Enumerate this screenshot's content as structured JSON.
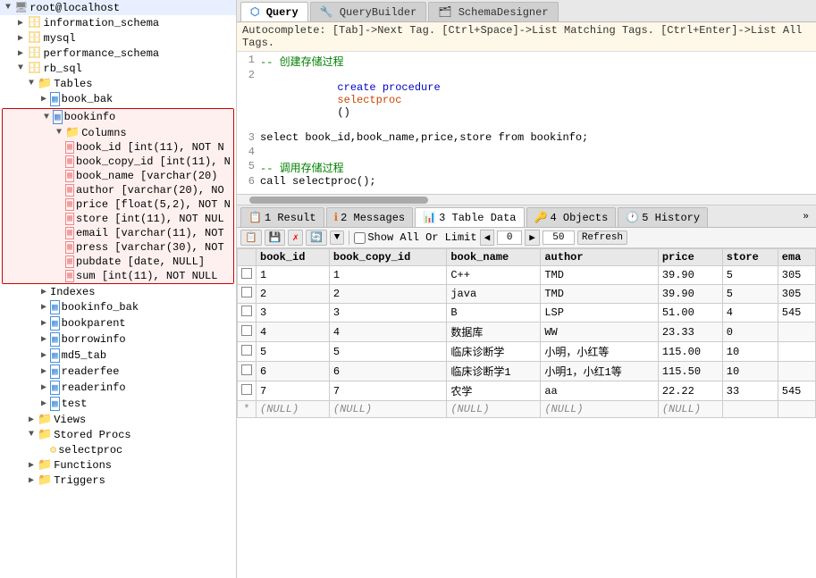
{
  "tabs": [
    {
      "label": "Query",
      "icon": "⬡",
      "active": true
    },
    {
      "label": "QueryBuilder",
      "icon": "🔧",
      "active": false
    },
    {
      "label": "SchemaDesigner",
      "icon": "🗂",
      "active": false
    }
  ],
  "autocomplete": "Autocomplete: [Tab]->Next Tag. [Ctrl+Space]->List Matching Tags. [Ctrl+Enter]->List All Tags.",
  "query_lines": [
    {
      "num": "1",
      "content": "-- 创建存储过程",
      "type": "comment"
    },
    {
      "num": "2",
      "content": "create procedure selectproc()",
      "type": "keyword"
    },
    {
      "num": "3",
      "content": "select book_id,book_name,price,store from bookinfo;",
      "type": "normal"
    },
    {
      "num": "4",
      "content": "",
      "type": "normal"
    },
    {
      "num": "5",
      "content": "-- 调用存储过程",
      "type": "comment"
    },
    {
      "num": "6",
      "content": "call selectproc();",
      "type": "normal"
    }
  ],
  "result_tabs": [
    {
      "label": "1 Result",
      "icon": "📋",
      "active": false
    },
    {
      "label": "2 Messages",
      "icon": "ℹ",
      "active": false
    },
    {
      "label": "3 Table Data",
      "icon": "📊",
      "active": true
    },
    {
      "label": "4 Objects",
      "icon": "🔑",
      "active": false
    },
    {
      "label": "5 History",
      "icon": "🕐",
      "active": false
    }
  ],
  "toolbar": {
    "show_all_label": "Show All Or",
    "limit_label": "Limit",
    "offset_value": "0",
    "count_value": "50",
    "refresh_label": "Refresh"
  },
  "table_headers": [
    "",
    "book_id",
    "book_copy_id",
    "book_name",
    "author",
    "price",
    "store",
    "ema"
  ],
  "table_rows": [
    {
      "book_id": "1",
      "book_copy_id": "1",
      "book_name": "C++",
      "author": "TMD",
      "price": "39.90",
      "store": "5",
      "email": "305"
    },
    {
      "book_id": "2",
      "book_copy_id": "2",
      "book_name": "java",
      "author": "TMD",
      "price": "39.90",
      "store": "5",
      "email": "305"
    },
    {
      "book_id": "3",
      "book_copy_id": "3",
      "book_name": "B",
      "author": "LSP",
      "price": "51.00",
      "store": "4",
      "email": "545"
    },
    {
      "book_id": "4",
      "book_copy_id": "4",
      "book_name": "数据库",
      "author": "WW",
      "price": "23.33",
      "store": "0",
      "email": ""
    },
    {
      "book_id": "5",
      "book_copy_id": "5",
      "book_name": "临床诊断学",
      "author": "小明，小红等",
      "price": "115.00",
      "store": "10",
      "email": ""
    },
    {
      "book_id": "6",
      "book_copy_id": "6",
      "book_name": "临床诊断学1",
      "author": "小明1，小红1等",
      "price": "115.50",
      "store": "10",
      "email": ""
    },
    {
      "book_id": "7",
      "book_copy_id": "7",
      "book_name": "农学",
      "author": "aa",
      "price": "22.22",
      "store": "33",
      "email": "545"
    }
  ],
  "null_row": {
    "book_id": "(NULL)",
    "book_copy_id": "(NULL)",
    "book_name": "(NULL)",
    "author": "(NULL)",
    "price": "(NULL)",
    "store": "",
    "email": ""
  },
  "sidebar": {
    "root": "root@localhost",
    "databases": [
      {
        "name": "information_schema",
        "expanded": false
      },
      {
        "name": "mysql",
        "expanded": false
      },
      {
        "name": "performance_schema",
        "expanded": false
      },
      {
        "name": "rb_sql",
        "expanded": true,
        "children": [
          {
            "type": "folder",
            "name": "Tables",
            "expanded": true,
            "children": [
              {
                "type": "table",
                "name": "book_bak",
                "expanded": false
              },
              {
                "type": "table",
                "name": "bookinfo",
                "expanded": true,
                "selected": true,
                "children": [
                  {
                    "type": "folder",
                    "name": "Columns",
                    "expanded": true,
                    "children": [
                      {
                        "type": "column",
                        "name": "book_id [int(11), NOT N"
                      },
                      {
                        "type": "column",
                        "name": "book_copy_id [int(11), N"
                      },
                      {
                        "type": "column",
                        "name": "book_name [varchar(20)"
                      },
                      {
                        "type": "column",
                        "name": "author [varchar(20), NO"
                      },
                      {
                        "type": "column",
                        "name": "price [float(5,2), NOT N"
                      },
                      {
                        "type": "column",
                        "name": "store [int(11), NOT NUL"
                      },
                      {
                        "type": "column",
                        "name": "email [varchar(11), NOT"
                      },
                      {
                        "type": "column",
                        "name": "press [varchar(30), NOT"
                      },
                      {
                        "type": "column",
                        "name": "pubdate [date, NULL]"
                      },
                      {
                        "type": "column",
                        "name": "sum [int(11), NOT NULL"
                      }
                    ]
                  }
                ]
              },
              {
                "type": "folder-item",
                "name": "Indexes"
              },
              {
                "type": "table",
                "name": "bookinfo_bak",
                "expanded": false
              },
              {
                "type": "table",
                "name": "bookparent",
                "expanded": false
              },
              {
                "type": "table",
                "name": "borrowinfo",
                "expanded": false
              },
              {
                "type": "table",
                "name": "md5_tab",
                "expanded": false
              },
              {
                "type": "table",
                "name": "readerfee",
                "expanded": false
              },
              {
                "type": "table",
                "name": "readerinfo",
                "expanded": false
              },
              {
                "type": "table",
                "name": "test",
                "expanded": false
              }
            ]
          },
          {
            "type": "folder",
            "name": "Views",
            "expanded": false
          },
          {
            "type": "folder",
            "name": "Stored Procs",
            "expanded": true,
            "children": [
              {
                "type": "proc",
                "name": "selectproc"
              }
            ]
          },
          {
            "type": "folder",
            "name": "Functions",
            "expanded": false
          },
          {
            "type": "folder",
            "name": "Triggers",
            "expanded": false
          }
        ]
      }
    ]
  }
}
